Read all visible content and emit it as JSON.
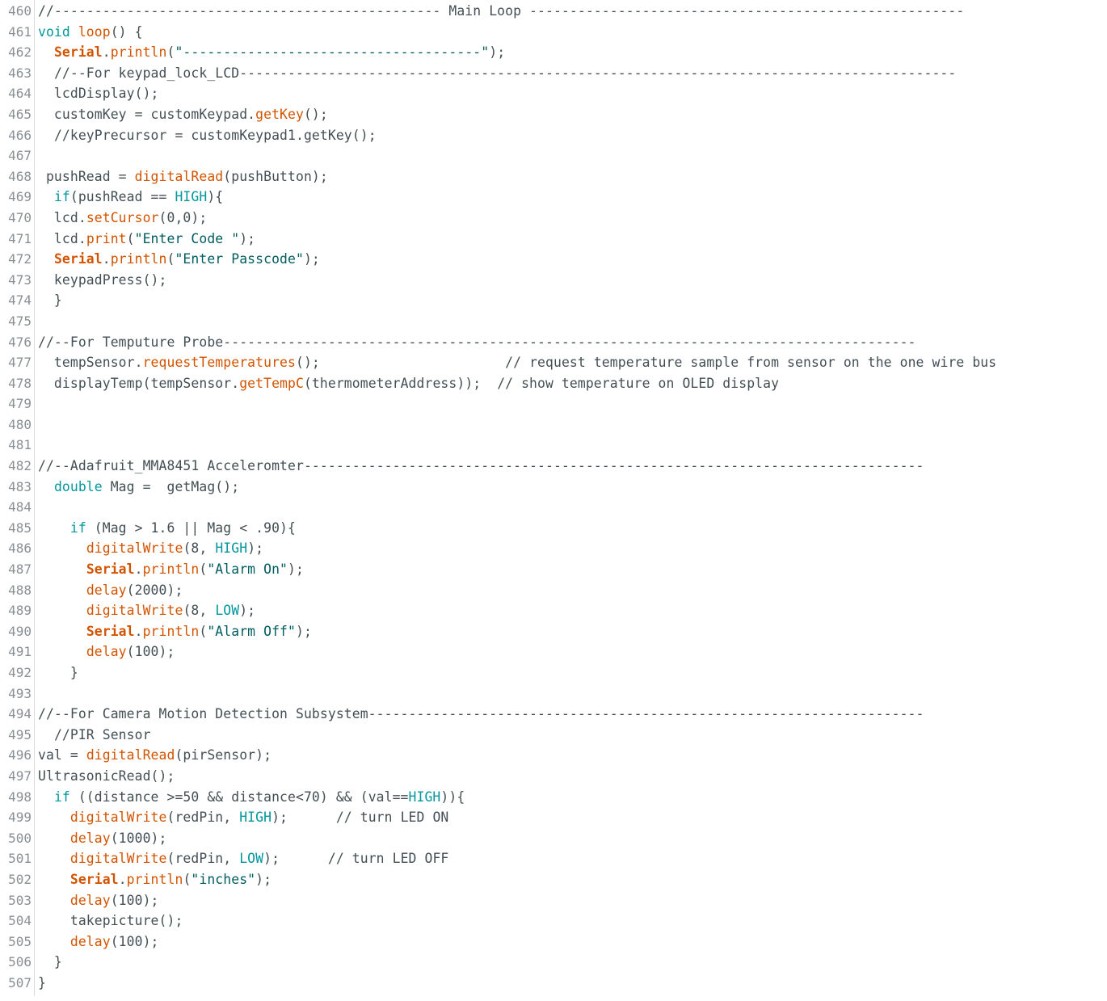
{
  "editor": {
    "colors": {
      "text": "#434f54",
      "function": "#d35400",
      "keyword_type": "#00979c",
      "string": "#005c5f",
      "line_number": "#8a8f94",
      "background": "#ffffff"
    },
    "lines": [
      {
        "n": "460",
        "tokens": [
          [
            "comment",
            "//------------------------------------------------ Main Loop ------------------------------------------------------"
          ]
        ]
      },
      {
        "n": "461",
        "tokens": [
          [
            "type",
            "void"
          ],
          [
            "text",
            " "
          ],
          [
            "func",
            "loop"
          ],
          [
            "text",
            "() {"
          ]
        ]
      },
      {
        "n": "462",
        "tokens": [
          [
            "text",
            "  "
          ],
          [
            "class",
            "Serial"
          ],
          [
            "text",
            "."
          ],
          [
            "func",
            "println"
          ],
          [
            "text",
            "("
          ],
          [
            "string",
            "\"-------------------------------------\""
          ],
          [
            "text",
            ");"
          ]
        ]
      },
      {
        "n": "463",
        "tokens": [
          [
            "text",
            "  "
          ],
          [
            "comment",
            "//--For keypad_lock_LCD-----------------------------------------------------------------------------------------"
          ]
        ]
      },
      {
        "n": "464",
        "tokens": [
          [
            "text",
            "  lcdDisplay();"
          ]
        ]
      },
      {
        "n": "465",
        "tokens": [
          [
            "text",
            "  customKey = customKeypad."
          ],
          [
            "func",
            "getKey"
          ],
          [
            "text",
            "();"
          ]
        ]
      },
      {
        "n": "466",
        "tokens": [
          [
            "text",
            "  "
          ],
          [
            "comment",
            "//keyPrecursor = customKeypad1.getKey();"
          ]
        ]
      },
      {
        "n": "467",
        "tokens": []
      },
      {
        "n": "468",
        "tokens": [
          [
            "text",
            " pushRead = "
          ],
          [
            "func",
            "digitalRead"
          ],
          [
            "text",
            "(pushButton);"
          ]
        ]
      },
      {
        "n": "469",
        "tokens": [
          [
            "text",
            "  "
          ],
          [
            "type",
            "if"
          ],
          [
            "text",
            "(pushRead == "
          ],
          [
            "const",
            "HIGH"
          ],
          [
            "text",
            "){"
          ]
        ]
      },
      {
        "n": "470",
        "tokens": [
          [
            "text",
            "  lcd."
          ],
          [
            "func",
            "setCursor"
          ],
          [
            "text",
            "(0,0);"
          ]
        ]
      },
      {
        "n": "471",
        "tokens": [
          [
            "text",
            "  lcd."
          ],
          [
            "func",
            "print"
          ],
          [
            "text",
            "("
          ],
          [
            "string",
            "\"Enter Code \""
          ],
          [
            "text",
            ");"
          ]
        ]
      },
      {
        "n": "472",
        "tokens": [
          [
            "text",
            "  "
          ],
          [
            "class",
            "Serial"
          ],
          [
            "text",
            "."
          ],
          [
            "func",
            "println"
          ],
          [
            "text",
            "("
          ],
          [
            "string",
            "\"Enter Passcode\""
          ],
          [
            "text",
            ");"
          ]
        ]
      },
      {
        "n": "473",
        "tokens": [
          [
            "text",
            "  keypadPress();"
          ]
        ]
      },
      {
        "n": "474",
        "tokens": [
          [
            "text",
            "  }"
          ]
        ]
      },
      {
        "n": "475",
        "tokens": []
      },
      {
        "n": "476",
        "tokens": [
          [
            "comment",
            "//--For Temputure Probe--------------------------------------------------------------------------------------"
          ]
        ]
      },
      {
        "n": "477",
        "tokens": [
          [
            "text",
            "  tempSensor."
          ],
          [
            "func",
            "requestTemperatures"
          ],
          [
            "text",
            "();                       "
          ],
          [
            "comment",
            "// request temperature sample from sensor on the one wire bus"
          ]
        ]
      },
      {
        "n": "478",
        "tokens": [
          [
            "text",
            "  displayTemp(tempSensor."
          ],
          [
            "func",
            "getTempC"
          ],
          [
            "text",
            "(thermometerAddress));  "
          ],
          [
            "comment",
            "// show temperature on OLED display"
          ]
        ]
      },
      {
        "n": "479",
        "tokens": []
      },
      {
        "n": "480",
        "tokens": []
      },
      {
        "n": "481",
        "tokens": []
      },
      {
        "n": "482",
        "tokens": [
          [
            "comment",
            "//--Adafruit_MMA8451 Acceleromter-----------------------------------------------------------------------------"
          ]
        ]
      },
      {
        "n": "483",
        "tokens": [
          [
            "text",
            "  "
          ],
          [
            "type",
            "double"
          ],
          [
            "text",
            " Mag =  getMag();"
          ]
        ]
      },
      {
        "n": "484",
        "tokens": []
      },
      {
        "n": "485",
        "tokens": [
          [
            "text",
            "    "
          ],
          [
            "type",
            "if"
          ],
          [
            "text",
            " (Mag > 1.6 || Mag < .90){"
          ]
        ]
      },
      {
        "n": "486",
        "tokens": [
          [
            "text",
            "      "
          ],
          [
            "func",
            "digitalWrite"
          ],
          [
            "text",
            "(8, "
          ],
          [
            "const",
            "HIGH"
          ],
          [
            "text",
            ");"
          ]
        ]
      },
      {
        "n": "487",
        "tokens": [
          [
            "text",
            "      "
          ],
          [
            "class",
            "Serial"
          ],
          [
            "text",
            "."
          ],
          [
            "func",
            "println"
          ],
          [
            "text",
            "("
          ],
          [
            "string",
            "\"Alarm On\""
          ],
          [
            "text",
            ");"
          ]
        ]
      },
      {
        "n": "488",
        "tokens": [
          [
            "text",
            "      "
          ],
          [
            "func",
            "delay"
          ],
          [
            "text",
            "(2000);"
          ]
        ]
      },
      {
        "n": "489",
        "tokens": [
          [
            "text",
            "      "
          ],
          [
            "func",
            "digitalWrite"
          ],
          [
            "text",
            "(8, "
          ],
          [
            "const",
            "LOW"
          ],
          [
            "text",
            ");"
          ]
        ]
      },
      {
        "n": "490",
        "tokens": [
          [
            "text",
            "      "
          ],
          [
            "class",
            "Serial"
          ],
          [
            "text",
            "."
          ],
          [
            "func",
            "println"
          ],
          [
            "text",
            "("
          ],
          [
            "string",
            "\"Alarm Off\""
          ],
          [
            "text",
            ");"
          ]
        ]
      },
      {
        "n": "491",
        "tokens": [
          [
            "text",
            "      "
          ],
          [
            "func",
            "delay"
          ],
          [
            "text",
            "(100);"
          ]
        ]
      },
      {
        "n": "492",
        "tokens": [
          [
            "text",
            "    }"
          ]
        ]
      },
      {
        "n": "493",
        "tokens": []
      },
      {
        "n": "494",
        "tokens": [
          [
            "comment",
            "//--For Camera Motion Detection Subsystem---------------------------------------------------------------------"
          ]
        ]
      },
      {
        "n": "495",
        "tokens": [
          [
            "text",
            "  "
          ],
          [
            "comment",
            "//PIR Sensor"
          ]
        ]
      },
      {
        "n": "496",
        "tokens": [
          [
            "text",
            "val = "
          ],
          [
            "func",
            "digitalRead"
          ],
          [
            "text",
            "(pirSensor);"
          ]
        ]
      },
      {
        "n": "497",
        "tokens": [
          [
            "text",
            "UltrasonicRead();"
          ]
        ]
      },
      {
        "n": "498",
        "tokens": [
          [
            "text",
            "  "
          ],
          [
            "type",
            "if"
          ],
          [
            "text",
            " ((distance >=50 && distance<70) && (val=="
          ],
          [
            "const",
            "HIGH"
          ],
          [
            "text",
            ")){"
          ]
        ]
      },
      {
        "n": "499",
        "tokens": [
          [
            "text",
            "    "
          ],
          [
            "func",
            "digitalWrite"
          ],
          [
            "text",
            "(redPin, "
          ],
          [
            "const",
            "HIGH"
          ],
          [
            "text",
            ");      "
          ],
          [
            "comment",
            "// turn LED ON"
          ]
        ]
      },
      {
        "n": "500",
        "tokens": [
          [
            "text",
            "    "
          ],
          [
            "func",
            "delay"
          ],
          [
            "text",
            "(1000);"
          ]
        ]
      },
      {
        "n": "501",
        "tokens": [
          [
            "text",
            "    "
          ],
          [
            "func",
            "digitalWrite"
          ],
          [
            "text",
            "(redPin, "
          ],
          [
            "const",
            "LOW"
          ],
          [
            "text",
            ");      "
          ],
          [
            "comment",
            "// turn LED OFF"
          ]
        ]
      },
      {
        "n": "502",
        "tokens": [
          [
            "text",
            "    "
          ],
          [
            "class",
            "Serial"
          ],
          [
            "text",
            "."
          ],
          [
            "func",
            "println"
          ],
          [
            "text",
            "("
          ],
          [
            "string",
            "\"inches\""
          ],
          [
            "text",
            ");"
          ]
        ]
      },
      {
        "n": "503",
        "tokens": [
          [
            "text",
            "    "
          ],
          [
            "func",
            "delay"
          ],
          [
            "text",
            "(100);"
          ]
        ]
      },
      {
        "n": "504",
        "tokens": [
          [
            "text",
            "    takepicture();"
          ]
        ]
      },
      {
        "n": "505",
        "tokens": [
          [
            "text",
            "    "
          ],
          [
            "func",
            "delay"
          ],
          [
            "text",
            "(100);"
          ]
        ]
      },
      {
        "n": "506",
        "tokens": [
          [
            "text",
            "  }"
          ]
        ]
      },
      {
        "n": "507",
        "tokens": [
          [
            "text",
            "}"
          ]
        ]
      }
    ]
  }
}
